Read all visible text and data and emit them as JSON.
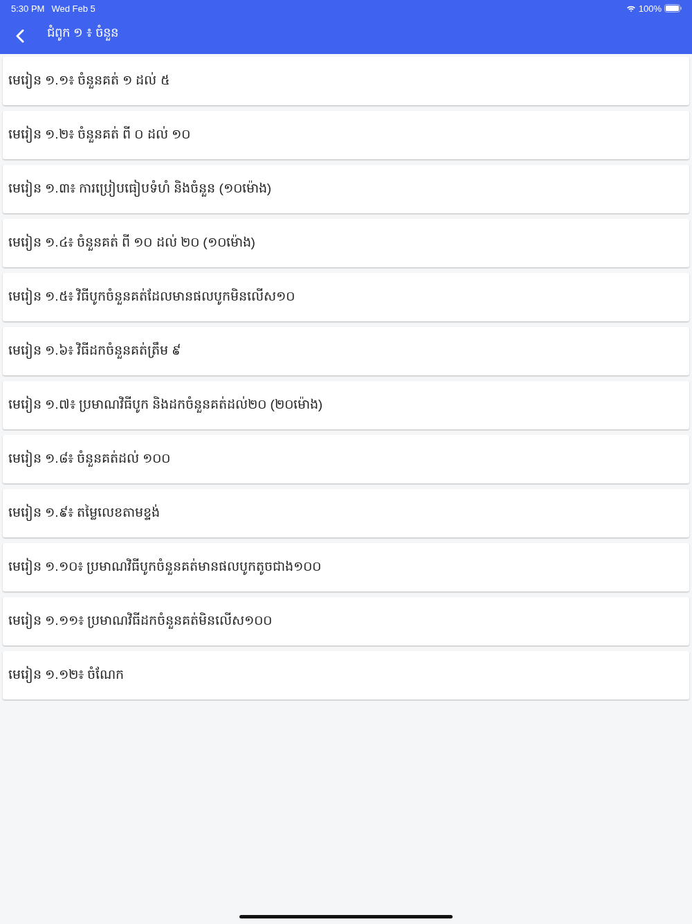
{
  "status_bar": {
    "time": "5:30 PM",
    "date": "Wed Feb 5",
    "battery": "100%"
  },
  "header": {
    "title": "ជំពូក ១ ៖ ចំនួន"
  },
  "lessons": [
    {
      "title": "មេរៀន ១.១៖ ចំនួនគត់ ១ ដល់ ៥"
    },
    {
      "title": "មេរៀន ១.២៖ ចំនួនគត់ ពី ០ ដល់ ១០"
    },
    {
      "title": "មេរៀន ១.៣៖ ការប្រៀបធៀបទំហំ និងចំនួន (១០ម៉ោង)"
    },
    {
      "title": "មេរៀន ១.៤៖ ចំនួនគត់ ពី ១០ ដល់ ២០ (១០ម៉ោង)"
    },
    {
      "title": "មេរៀន ១.៥៖ វិធីបូកចំនួនគត់ដែលមានផលបូកមិនលើស១០"
    },
    {
      "title": "មេរៀន ១.៦៖ វិធីដកចំនួនគត់ត្រឹម ៩"
    },
    {
      "title": "មេរៀន ១.៧៖ ប្រមាណវិធីបូក និងដកចំនួនគត់ដល់២០ (២០ម៉ោង)"
    },
    {
      "title": "មេរៀន ១.៨៖ ចំនួនគត់ដល់ ១០០"
    },
    {
      "title": "មេរៀន ១.៩៖ តម្លៃលេខតាមខ្ទង់"
    },
    {
      "title": "មេរៀន ១.១០៖ ប្រមាណវិធីបូកចំនួនគត់មានផលបូកតូចជាង១០០"
    },
    {
      "title": "មេរៀន ១.១១៖ ប្រមាណវិធីដកចំនួនគត់មិនលើស១០០"
    },
    {
      "title": "មេរៀន ១.១២៖ ចំណែក"
    }
  ]
}
